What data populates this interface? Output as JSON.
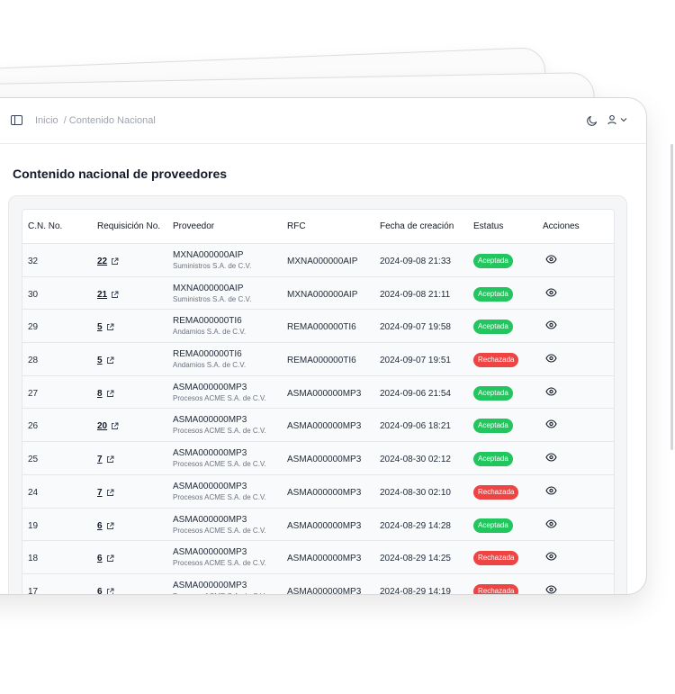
{
  "breadcrumb": {
    "home": "Inicio",
    "current": "/ Contenido Nacional"
  },
  "page": {
    "title": "Contenido nacional de proveedores"
  },
  "table": {
    "headers": [
      "C.N. No.",
      "Requisición No.",
      "Proveedor",
      "RFC",
      "Fecha de creación",
      "Estatus",
      "Acciones"
    ],
    "rows": [
      {
        "cn": "32",
        "req": "22",
        "prov_rfc": "MXNA000000AIP",
        "prov_name": "Suministros S.A. de C.V.",
        "rfc": "MXNA000000AIP",
        "fecha": "2024-09-08 21:33",
        "estatus": "Aceptada"
      },
      {
        "cn": "30",
        "req": "21",
        "prov_rfc": "MXNA000000AIP",
        "prov_name": "Suministros S.A. de C.V.",
        "rfc": "MXNA000000AIP",
        "fecha": "2024-09-08 21:11",
        "estatus": "Aceptada"
      },
      {
        "cn": "29",
        "req": "5",
        "prov_rfc": "REMA000000TI6",
        "prov_name": "Andamios S.A. de C.V.",
        "rfc": "REMA000000TI6",
        "fecha": "2024-09-07 19:58",
        "estatus": "Aceptada"
      },
      {
        "cn": "28",
        "req": "5",
        "prov_rfc": "REMA000000TI6",
        "prov_name": "Andamios S.A. de C.V.",
        "rfc": "REMA000000TI6",
        "fecha": "2024-09-07 19:51",
        "estatus": "Rechazada"
      },
      {
        "cn": "27",
        "req": "8",
        "prov_rfc": "ASMA000000MP3",
        "prov_name": "Procesos ACME S.A. de C.V.",
        "rfc": "ASMA000000MP3",
        "fecha": "2024-09-06 21:54",
        "estatus": "Aceptada"
      },
      {
        "cn": "26",
        "req": "20",
        "prov_rfc": "ASMA000000MP3",
        "prov_name": "Procesos ACME S.A. de C.V.",
        "rfc": "ASMA000000MP3",
        "fecha": "2024-09-06 18:21",
        "estatus": "Aceptada"
      },
      {
        "cn": "25",
        "req": "7",
        "prov_rfc": "ASMA000000MP3",
        "prov_name": "Procesos ACME S.A. de C.V.",
        "rfc": "ASMA000000MP3",
        "fecha": "2024-08-30 02:12",
        "estatus": "Aceptada"
      },
      {
        "cn": "24",
        "req": "7",
        "prov_rfc": "ASMA000000MP3",
        "prov_name": "Procesos ACME S.A. de C.V.",
        "rfc": "ASMA000000MP3",
        "fecha": "2024-08-30 02:10",
        "estatus": "Rechazada"
      },
      {
        "cn": "19",
        "req": "6",
        "prov_rfc": "ASMA000000MP3",
        "prov_name": "Procesos ACME S.A. de C.V.",
        "rfc": "ASMA000000MP3",
        "fecha": "2024-08-29 14:28",
        "estatus": "Aceptada"
      },
      {
        "cn": "18",
        "req": "6",
        "prov_rfc": "ASMA000000MP3",
        "prov_name": "Procesos ACME S.A. de C.V.",
        "rfc": "ASMA000000MP3",
        "fecha": "2024-08-29 14:25",
        "estatus": "Rechazada"
      },
      {
        "cn": "17",
        "req": "6",
        "prov_rfc": "ASMA000000MP3",
        "prov_name": "Procesos ACME S.A. de C.V.",
        "rfc": "ASMA000000MP3",
        "fecha": "2024-08-29 14:19",
        "estatus": "Rechazada"
      }
    ]
  },
  "colors": {
    "accepted": "#22c55e",
    "rejected": "#ef4444"
  },
  "icons": {
    "sidebar": "sidebar-toggle-icon",
    "theme": "moon-icon",
    "user": "user-icon",
    "external": "external-link-icon",
    "view": "eye-icon"
  }
}
